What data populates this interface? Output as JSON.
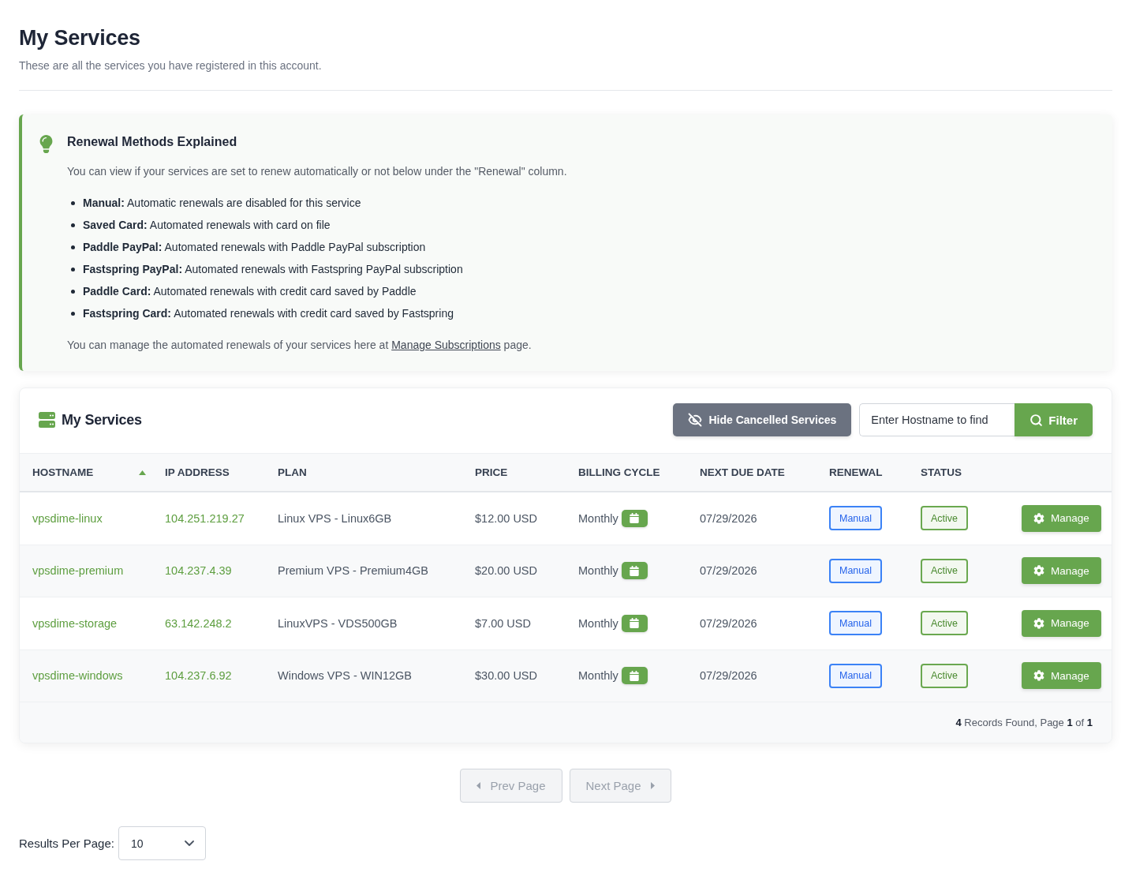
{
  "page": {
    "title": "My Services",
    "subtitle": "These are all the services you have registered in this account."
  },
  "notice": {
    "title": "Renewal Methods Explained",
    "intro": "You can view if your services are set to renew automatically or not below under the \"Renewal\" column.",
    "items": [
      "**Manual:** Automatic renewals are disabled for this service",
      "**Saved Card:** Automated renewals with card on file",
      "**Paddle PayPal:** Automated renewals with Paddle PayPal subscription",
      "**Fastspring PayPal:** Automated renewals with Fastspring PayPal subscription",
      "**Paddle Card:** Automated renewals with credit card saved by Paddle",
      "**Fastspring Card:** Automated renewals with credit card saved by Fastspring"
    ],
    "note": {
      "before": "You can manage the automated renewals of your services here at",
      "link": "Manage Subscriptions",
      "after": "page."
    }
  },
  "services": {
    "title": "My Services",
    "hide_button": "Hide Cancelled Services",
    "search": {
      "placeholder": "Enter Hostname to find"
    },
    "filter_button": "Filter",
    "columns": [
      {
        "label": "HOSTNAME",
        "sorted": true
      },
      {
        "label": "IP ADDRESS",
        "sorted": false
      },
      {
        "label": "PLAN",
        "sorted": false
      },
      {
        "label": "PRICE",
        "sorted": false
      },
      {
        "label": "BILLING CYCLE",
        "sorted": false
      },
      {
        "label": "NEXT DUE DATE",
        "sorted": false
      },
      {
        "label": "RENEWAL",
        "sorted": false
      },
      {
        "label": "STATUS",
        "sorted": false
      }
    ],
    "rows": [
      {
        "hostname": "vpsdime-linux",
        "ip": "104.251.219.27",
        "plan": "Linux VPS - Linux6GB",
        "price": "$12.00 USD",
        "billing_cycle": "Monthly",
        "next_due_date": "07/29/2026",
        "renewal": "Manual",
        "status": "Active",
        "action": "Manage"
      },
      {
        "hostname": "vpsdime-premium",
        "ip": "104.237.4.39",
        "plan": "Premium VPS - Premium4GB",
        "price": "$20.00 USD",
        "billing_cycle": "Monthly",
        "next_due_date": "07/29/2026",
        "renewal": "Manual",
        "status": "Active",
        "action": "Manage"
      },
      {
        "hostname": "vpsdime-storage",
        "ip": "63.142.248.2",
        "plan": "LinuxVPS - VDS500GB",
        "price": "$7.00 USD",
        "billing_cycle": "Monthly",
        "next_due_date": "07/29/2026",
        "renewal": "Manual",
        "status": "Active",
        "action": "Manage"
      },
      {
        "hostname": "vpsdime-windows",
        "ip": "104.237.6.92",
        "plan": "Windows VPS - WIN12GB",
        "price": "$30.00 USD",
        "billing_cycle": "Monthly",
        "next_due_date": "07/29/2026",
        "renewal": "Manual",
        "status": "Active",
        "action": "Manage"
      }
    ],
    "summary": "**4** Records Found, Page **1** of **1**"
  },
  "pagination": [
    {
      "kind": "prev",
      "label": "Prev Page",
      "disabled": true
    },
    {
      "kind": "next",
      "label": "Next Page",
      "disabled": true
    }
  ],
  "per_page": {
    "label": "Results Per Page:",
    "value": "10"
  }
}
